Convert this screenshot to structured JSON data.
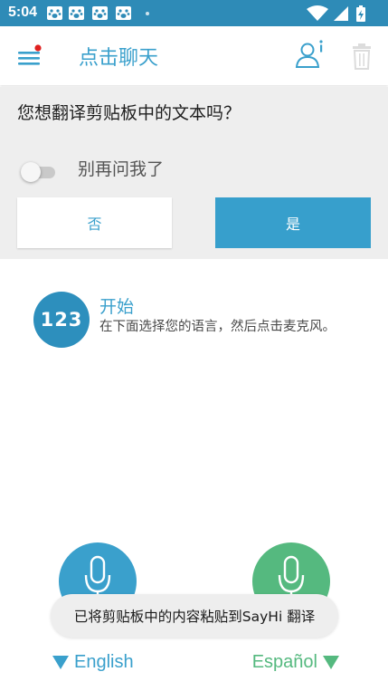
{
  "status_bar": {
    "time": "5:04",
    "app_icons": [
      "paw-icon",
      "paw-icon",
      "paw-icon",
      "paw-icon"
    ],
    "right_icons": [
      "wifi-icon",
      "signal-icon",
      "battery-charging-icon"
    ],
    "bg_color": "#2e8bb7"
  },
  "app_bar": {
    "title": "点击聊天",
    "accent": "#3aa0cc",
    "notification_dot_color": "#e0201f"
  },
  "clipboard_prompt": {
    "question": "您想翻译剪贴板中的文本吗？",
    "toggle_label": "别再问我了",
    "toggle_on": false,
    "no_label": "否",
    "yes_label": "是"
  },
  "getting_started": {
    "badge": "123",
    "title": "开始",
    "description": "在下面选择您的语言，然后点击麦克风。"
  },
  "toast": {
    "message": "已将剪贴板中的内容粘贴到SayHi 翻译"
  },
  "languages": {
    "left": "English",
    "right": "Español",
    "left_color": "#3aa0cc",
    "right_color": "#55b97f"
  }
}
